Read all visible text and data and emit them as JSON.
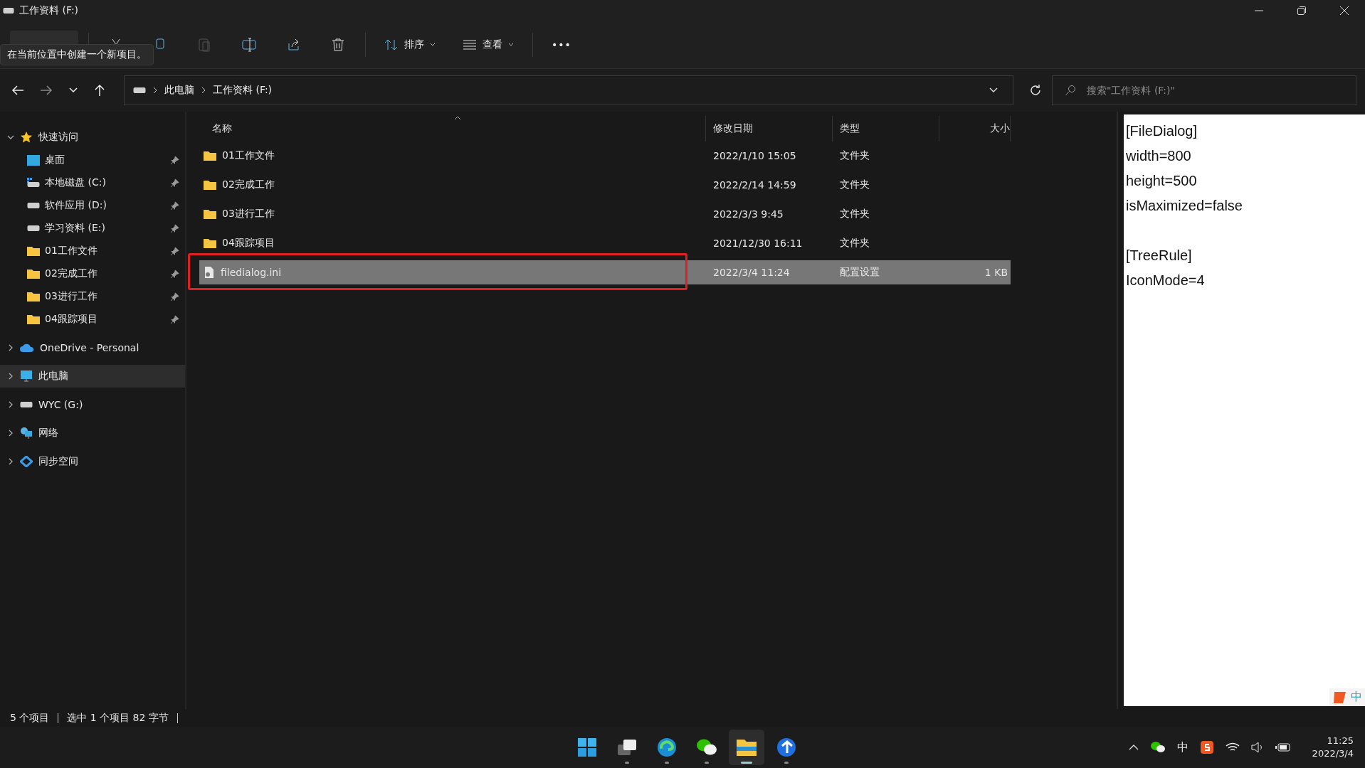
{
  "window": {
    "title": "工作资料 (F:)"
  },
  "toolbar": {
    "sort_button": "排序",
    "view_button": "查看",
    "more_button": "•••",
    "tooltip": "在当前位置中创建一个新项目。"
  },
  "address_bar": {
    "segments": [
      "此电脑",
      "工作资料 (F:)"
    ]
  },
  "search": {
    "placeholder": "搜索\"工作资料 (F:)\""
  },
  "sidebar": {
    "items": [
      {
        "label": "快速访问",
        "kind": "star",
        "expanded": true,
        "selected": false,
        "children": [
          {
            "label": "桌面",
            "kind": "desktop",
            "pinned": true
          },
          {
            "label": "本地磁盘 (C:)",
            "kind": "sysdrive",
            "pinned": true
          },
          {
            "label": "软件应用 (D:)",
            "kind": "drive",
            "pinned": true
          },
          {
            "label": "学习资料 (E:)",
            "kind": "drive",
            "pinned": true
          },
          {
            "label": "01工作文件",
            "kind": "folder",
            "pinned": true
          },
          {
            "label": "02完成工作",
            "kind": "folder",
            "pinned": true
          },
          {
            "label": "03进行工作",
            "kind": "folder",
            "pinned": true
          },
          {
            "label": "04跟踪项目",
            "kind": "folder",
            "pinned": true
          }
        ]
      },
      {
        "label": "OneDrive - Personal",
        "kind": "cloud",
        "expanded": false,
        "selected": false
      },
      {
        "label": "此电脑",
        "kind": "pc",
        "expanded": false,
        "selected": true
      },
      {
        "label": "WYC (G:)",
        "kind": "drive",
        "expanded": false,
        "selected": false
      },
      {
        "label": "网络",
        "kind": "network",
        "expanded": false,
        "selected": false
      },
      {
        "label": "同步空间",
        "kind": "sync",
        "expanded": false,
        "selected": false
      }
    ]
  },
  "table": {
    "columns": [
      "名称",
      "修改日期",
      "类型",
      "大小"
    ],
    "rows": [
      {
        "name": "01工作文件",
        "date": "2022/1/10 15:05",
        "type": "文件夹",
        "kind": "folder",
        "selected": false
      },
      {
        "name": "02完成工作",
        "date": "2022/2/14 14:59",
        "type": "文件夹",
        "kind": "folder",
        "selected": false
      },
      {
        "name": "03进行工作",
        "date": "2022/3/3 9:45",
        "type": "文件夹",
        "kind": "folder",
        "selected": false
      },
      {
        "name": "04跟踪项目",
        "date": "2021/12/30 16:11",
        "type": "文件夹",
        "kind": "folder",
        "selected": false
      },
      {
        "name": "filedialog.ini",
        "date": "2022/3/4 11:24",
        "type": "配置设置",
        "size": "1 KB",
        "kind": "ini",
        "selected": true
      }
    ]
  },
  "preview": {
    "sections": [
      {
        "lines": [
          "[FileDialog]",
          "width=800",
          "height=500",
          "isMaximized=false"
        ]
      },
      {
        "lines": [
          "[TreeRule]",
          "IconMode=4"
        ]
      }
    ]
  },
  "status_bar": {
    "items": [
      "5 个项目",
      "选中 1 个项目  82 字节"
    ]
  },
  "ime_badge": "中",
  "taskbar": {
    "apps": [
      {
        "kind": "start",
        "active": false
      },
      {
        "kind": "taskview",
        "active": false
      },
      {
        "kind": "edge",
        "active": false
      },
      {
        "kind": "wechat",
        "active": false
      },
      {
        "kind": "explorer",
        "active": true
      },
      {
        "kind": "tool",
        "active": false
      }
    ],
    "tray_input": "中",
    "time": "11:25",
    "date": "2022/3/4"
  }
}
